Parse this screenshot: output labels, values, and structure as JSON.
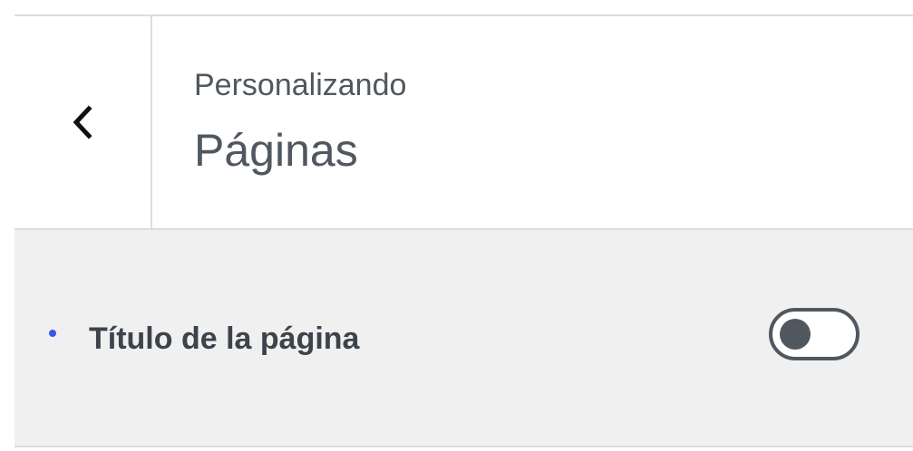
{
  "header": {
    "back_icon": "chevron-left-icon",
    "eyebrow": "Personalizando",
    "title": "Páginas"
  },
  "settings": {
    "items": [
      {
        "label": "Título de la página",
        "enabled": false,
        "indicator_color": "#3858e9"
      }
    ]
  },
  "colors": {
    "border": "#dcdcde",
    "panel_background": "#f0f0f1",
    "text": "#50575e",
    "label_text": "#3c434a",
    "accent": "#3858e9"
  }
}
